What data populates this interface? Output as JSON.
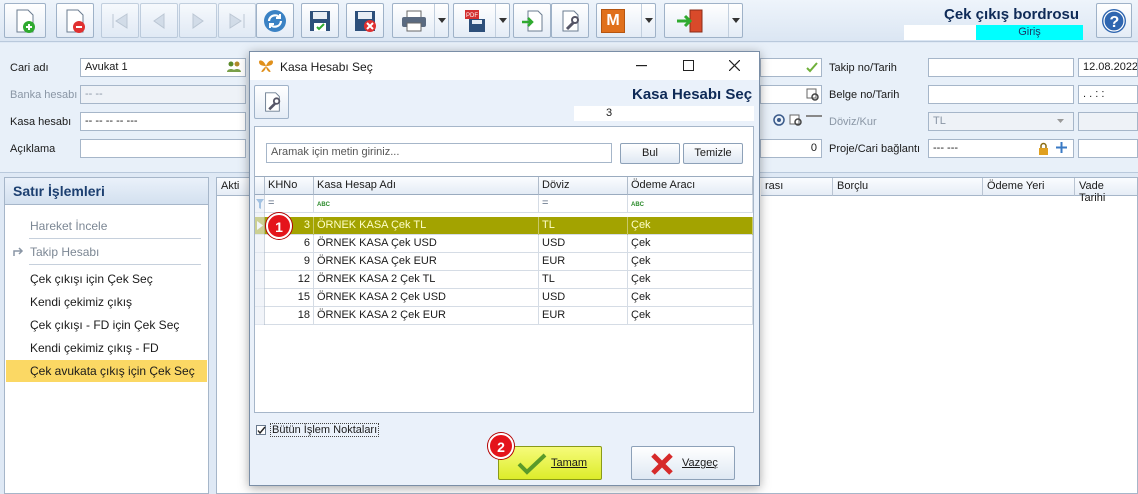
{
  "header": {
    "title": "Çek çıkış bordrosu",
    "mode": "Giriş",
    "colors": {
      "title": "#0e2a57",
      "mode_bg": "#00ffff"
    }
  },
  "toolbar": {
    "icons": [
      "new-doc-icon",
      "delete-doc-icon",
      "first-record-icon",
      "prev-record-icon",
      "next-record-icon",
      "last-record-icon",
      "refresh-icon",
      "save-icon",
      "save-close-icon",
      "print-icon",
      "pdf-icon",
      "import-icon",
      "settings-icon",
      "m-icon",
      "exit-icon"
    ],
    "m_label": "M"
  },
  "form": {
    "cari_adi_label": "Cari adı",
    "cari_adi_value": "Avukat 1",
    "banka_hesabi_label": "Banka hesabı",
    "banka_hesabi_value": "-- --",
    "kasa_hesabi_label": "Kasa hesabı",
    "kasa_hesabi_value": "-- -- -- -- ---",
    "aciklama_label": "Açıklama",
    "aciklama_value": "",
    "takip_no_label": "Takip no/Tarih",
    "takip_date": "12.08.2022",
    "belge_no_label": "Belge no/Tarih",
    "belge_date": ".  .   : :",
    "doviz_label": "Döviz/Kur",
    "doviz_value": "TL",
    "proje_label": "Proje/Cari bağlantı",
    "proje_value": "--- ---",
    "zero_value": "0"
  },
  "left_panel": {
    "title": "Satır İşlemleri",
    "items": [
      {
        "label": "Hareket İncele",
        "disabled": true
      },
      {
        "label": "Takip Hesabı",
        "disabled": true
      },
      {
        "label": "Çek çıkışı için Çek Seç",
        "disabled": false
      },
      {
        "label": "Kendi çekimiz çıkış",
        "disabled": false
      },
      {
        "label": "Çek çıkışı - FD için Çek Seç",
        "disabled": false
      },
      {
        "label": "Kendi çekimiz çıkış - FD",
        "disabled": false
      },
      {
        "label": "Çek avukata çıkış için Çek Seç",
        "disabled": false,
        "selected": true
      }
    ]
  },
  "main_grid": {
    "columns": [
      "Akti",
      "rası",
      "Borçlu",
      "Ödeme Yeri",
      "Vade Tarihi"
    ]
  },
  "dialog": {
    "title": "Kasa Hesabı Seç",
    "heading": "Kasa Hesabı Seç",
    "count": "3",
    "search_placeholder": "Aramak için metin giriniz...",
    "find_button": "Bul",
    "clear_button": "Temizle",
    "columns": {
      "khno": "KHNo",
      "name": "Kasa Hesap Adı",
      "currency": "Döviz",
      "payment": "Ödeme Aracı"
    },
    "filter_eq": "=",
    "filter_abc": "ABC",
    "rows": [
      {
        "khno": "3",
        "name": "ÖRNEK KASA Çek TL",
        "currency": "TL",
        "payment": "Çek"
      },
      {
        "khno": "6",
        "name": "ÖRNEK KASA Çek USD",
        "currency": "USD",
        "payment": "Çek"
      },
      {
        "khno": "9",
        "name": "ÖRNEK KASA Çek EUR",
        "currency": "EUR",
        "payment": "Çek"
      },
      {
        "khno": "12",
        "name": "ÖRNEK KASA 2 Çek TL",
        "currency": "TL",
        "payment": "Çek"
      },
      {
        "khno": "15",
        "name": "ÖRNEK KASA 2 Çek USD",
        "currency": "USD",
        "payment": "Çek"
      },
      {
        "khno": "18",
        "name": "ÖRNEK KASA 2 Çek EUR",
        "currency": "EUR",
        "payment": "Çek"
      }
    ],
    "all_points_label": "Bütün İşlem Noktaları",
    "all_points_checked": true,
    "ok_button": "Tamam",
    "cancel_button": "Vazgeç",
    "selection_color": "#a3a300"
  },
  "annotations": {
    "badge_1": "1",
    "badge_2": "2"
  }
}
